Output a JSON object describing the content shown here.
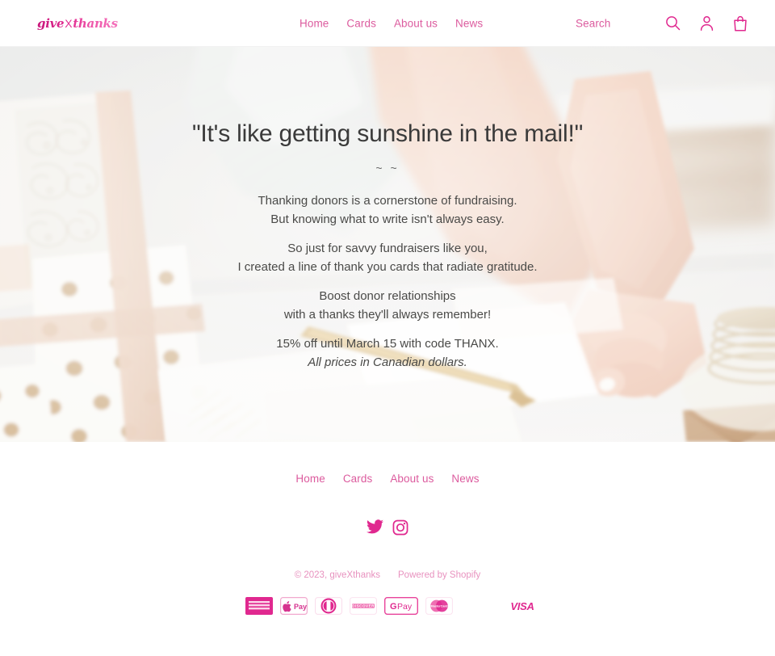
{
  "brand": {
    "logo_text_part1": "give",
    "logo_text_x": "X",
    "logo_text_part2": "thanks",
    "accent_pink": "#dc5b9e",
    "deep_pink": "#e0288f",
    "light_pink": "#e892bf"
  },
  "header": {
    "nav": [
      {
        "label": "Home"
      },
      {
        "label": "Cards"
      },
      {
        "label": "About us"
      },
      {
        "label": "News"
      }
    ],
    "search_label": "Search",
    "icons": [
      {
        "name": "search-icon",
        "title": "Search"
      },
      {
        "name": "account-icon",
        "title": "Log in"
      },
      {
        "name": "cart-icon",
        "title": "Cart"
      }
    ]
  },
  "hero": {
    "title": "\"It's like getting sunshine in the mail!\"",
    "divider": "~ ~",
    "paragraphs": [
      {
        "line1": "Thanking donors is a cornerstone of fundraising.",
        "line2": "But knowing what to write isn't always easy."
      },
      {
        "line1": "So just for savvy fundraisers like you,",
        "line2": "I created a line of thank you cards that radiate gratitude."
      },
      {
        "line1": "Boost donor relationships",
        "line2": "with a thanks they'll always remember!"
      }
    ],
    "promo_line": "15% off until March 15 with code THANX.",
    "currency_note": "All prices in Canadian dollars.",
    "image_description": "Gift-wrapped boxes with gold polka dots and paisley paper, a woman's hands writing a card, a kraft envelope and a spool of twine on a white table."
  },
  "footer": {
    "nav": [
      {
        "label": "Home"
      },
      {
        "label": "Cards"
      },
      {
        "label": "About us"
      },
      {
        "label": "News"
      }
    ],
    "social": [
      {
        "name": "twitter-icon",
        "label": "Twitter"
      },
      {
        "name": "instagram-icon",
        "label": "Instagram"
      }
    ],
    "copyright": "© 2023, giveXthanks",
    "powered_by": "Powered by Shopify",
    "payment_methods": [
      {
        "name": "american-express",
        "label": "American Express"
      },
      {
        "name": "apple-pay",
        "label": "Apple Pay"
      },
      {
        "name": "diners-club",
        "label": "Diners Club"
      },
      {
        "name": "discover",
        "label": "Discover"
      },
      {
        "name": "google-pay",
        "label": "Google Pay"
      },
      {
        "name": "mastercard",
        "label": "Mastercard"
      },
      {
        "name": "visa",
        "label": "Visa"
      }
    ],
    "visa_text": "VISA"
  }
}
